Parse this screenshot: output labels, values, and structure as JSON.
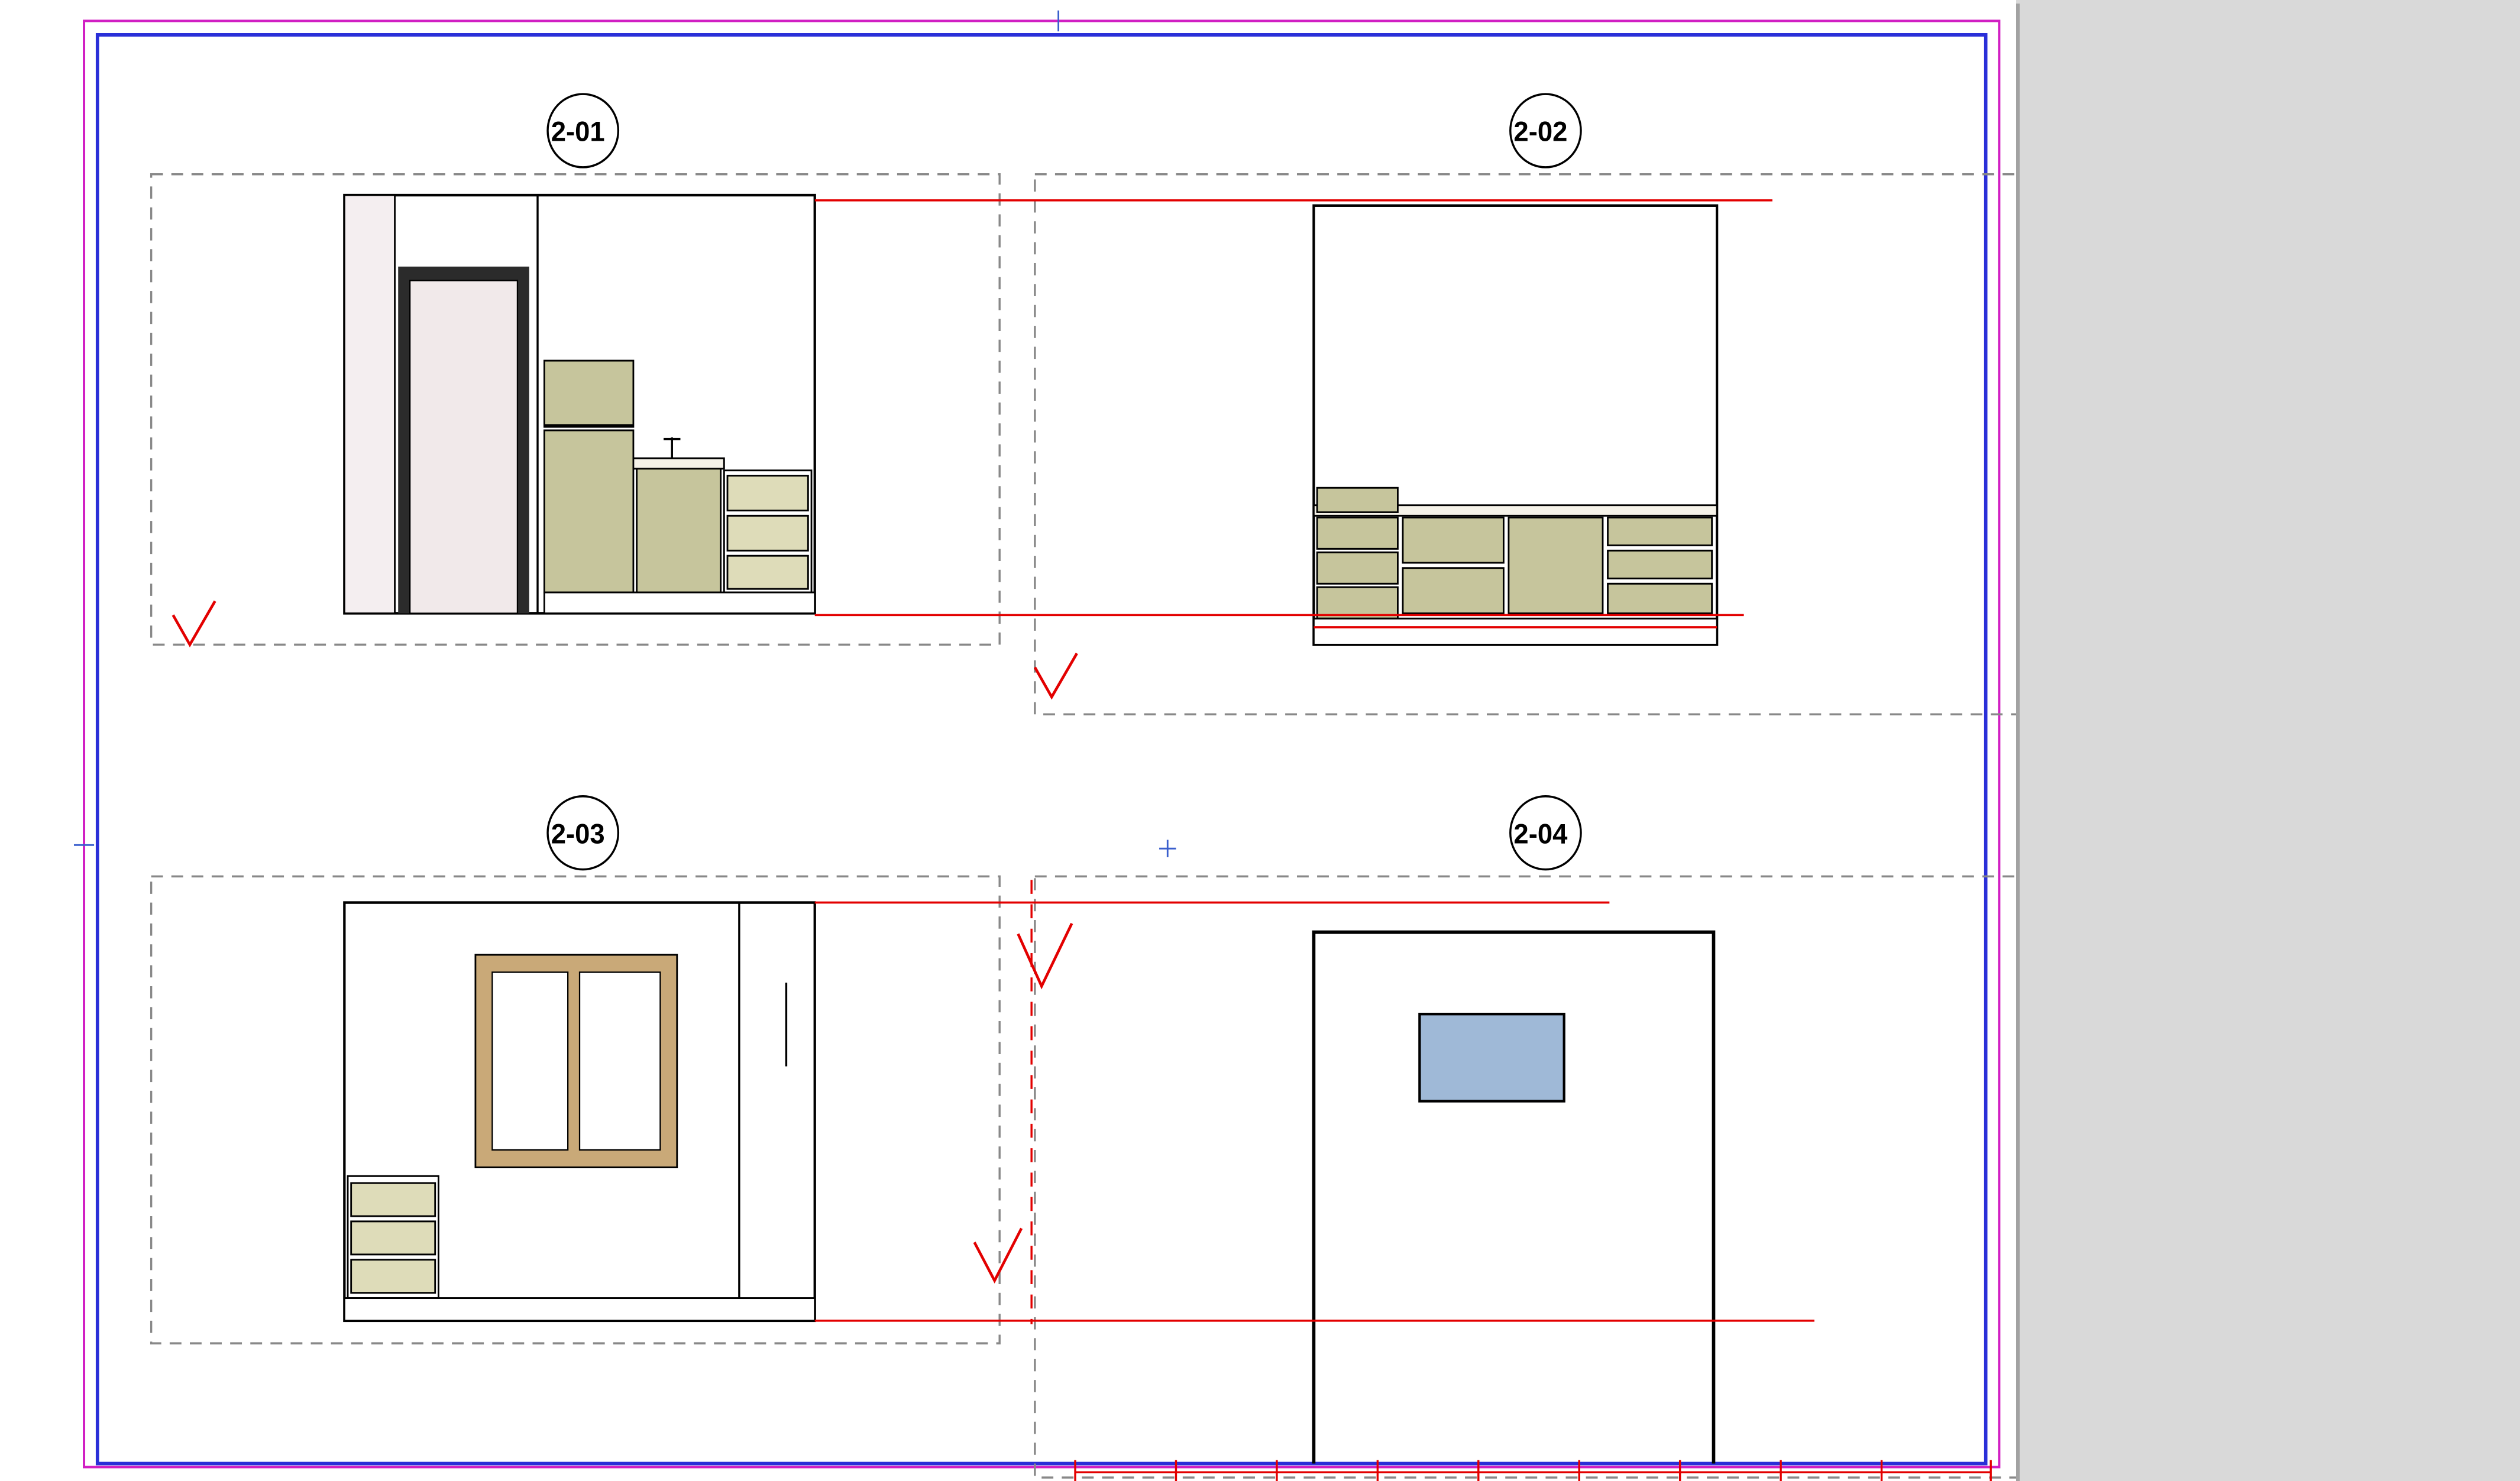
{
  "sheet": {
    "elevations": [
      {
        "tag": "2-01",
        "desc": "Kitchen elevation with door and cabinets"
      },
      {
        "tag": "2-02",
        "desc": "Kitchen elevation with base cabinets / drawers"
      },
      {
        "tag": "2-03",
        "desc": "Room elevation with window and drawer unit"
      },
      {
        "tag": "2-04",
        "desc": "Room elevation with small high window"
      }
    ]
  },
  "colors": {
    "cabinet": "#c6c59c",
    "cabinet_light": "#dedcb9",
    "window_frame": "#c9a978",
    "window_blue": "#9fb9d7",
    "door_panel": "#f1e9ea",
    "ref_line": "#e30000",
    "border_blue": "#2a2fd8",
    "border_magenta": "#d11fc3"
  }
}
